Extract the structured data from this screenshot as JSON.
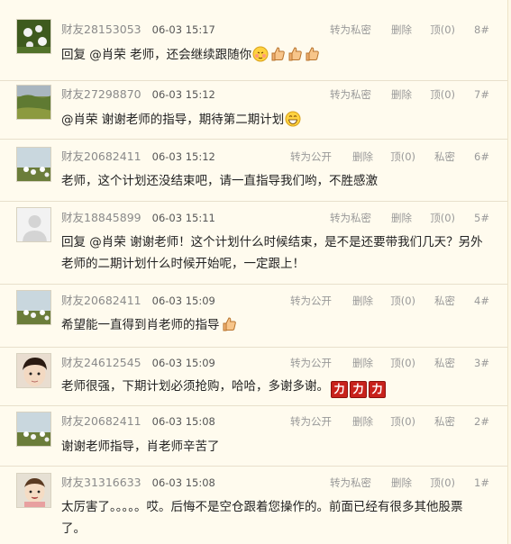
{
  "comments": [
    {
      "user": "财友28153053",
      "time": "06-03 15:17",
      "floor": "8#",
      "actions": [
        "转为私密",
        "删除",
        "顶(0)"
      ],
      "content": "回复 @肖荣 老师，还会继续跟随你",
      "emoticons": [
        "shy-face-emoticon",
        "thumbs-up-emoticon",
        "thumbs-up-emoticon",
        "thumbs-up-emoticon"
      ]
    },
    {
      "user": "财友27298870",
      "time": "06-03 15:12",
      "floor": "7#",
      "actions": [
        "转为私密",
        "删除",
        "顶(0)"
      ],
      "content": "@肖荣 谢谢老师的指导，期待第二期计划",
      "emoticons": [
        "grin-face-emoticon"
      ]
    },
    {
      "user": "财友20682411",
      "time": "06-03 15:12",
      "floor": "6#",
      "actions": [
        "转为公开",
        "删除",
        "顶(0)",
        "私密"
      ],
      "content": "老师，这个计划还没结束吧，请一直指导我们哟，不胜感激",
      "emoticons": []
    },
    {
      "user": "财友18845899",
      "time": "06-03 15:11",
      "floor": "5#",
      "actions": [
        "转为私密",
        "删除",
        "顶(0)"
      ],
      "content": "回复 @肖荣 谢谢老师！这个计划什么时候结束，是不是还要带我们几天？另外老师的二期计划什么时候开始呢，一定跟上！",
      "emoticons": []
    },
    {
      "user": "财友20682411",
      "time": "06-03 15:09",
      "floor": "4#",
      "actions": [
        "转为公开",
        "删除",
        "顶(0)",
        "私密"
      ],
      "content": "希望能一直得到肖老师的指导",
      "emoticons": [
        "thumbs-up-emoticon"
      ]
    },
    {
      "user": "财友24612545",
      "time": "06-03 15:09",
      "floor": "3#",
      "actions": [
        "转为公开",
        "删除",
        "顶(0)",
        "私密"
      ],
      "content": "老师很强，下期计划必须抢购，哈哈，多谢多谢。",
      "badges": [
        "力",
        "力",
        "力"
      ]
    },
    {
      "user": "财友20682411",
      "time": "06-03 15:08",
      "floor": "2#",
      "actions": [
        "转为公开",
        "删除",
        "顶(0)",
        "私密"
      ],
      "content": "谢谢老师指导，肖老师辛苦了",
      "emoticons": []
    },
    {
      "user": "财友31316633",
      "time": "06-03 15:08",
      "floor": "1#",
      "actions": [
        "转为私密",
        "删除",
        "顶(0)"
      ],
      "content": "太厉害了。。。。。哎。后悔不是空仓跟着您操作的。前面已经有很多其他股票了。",
      "emoticons": []
    }
  ]
}
